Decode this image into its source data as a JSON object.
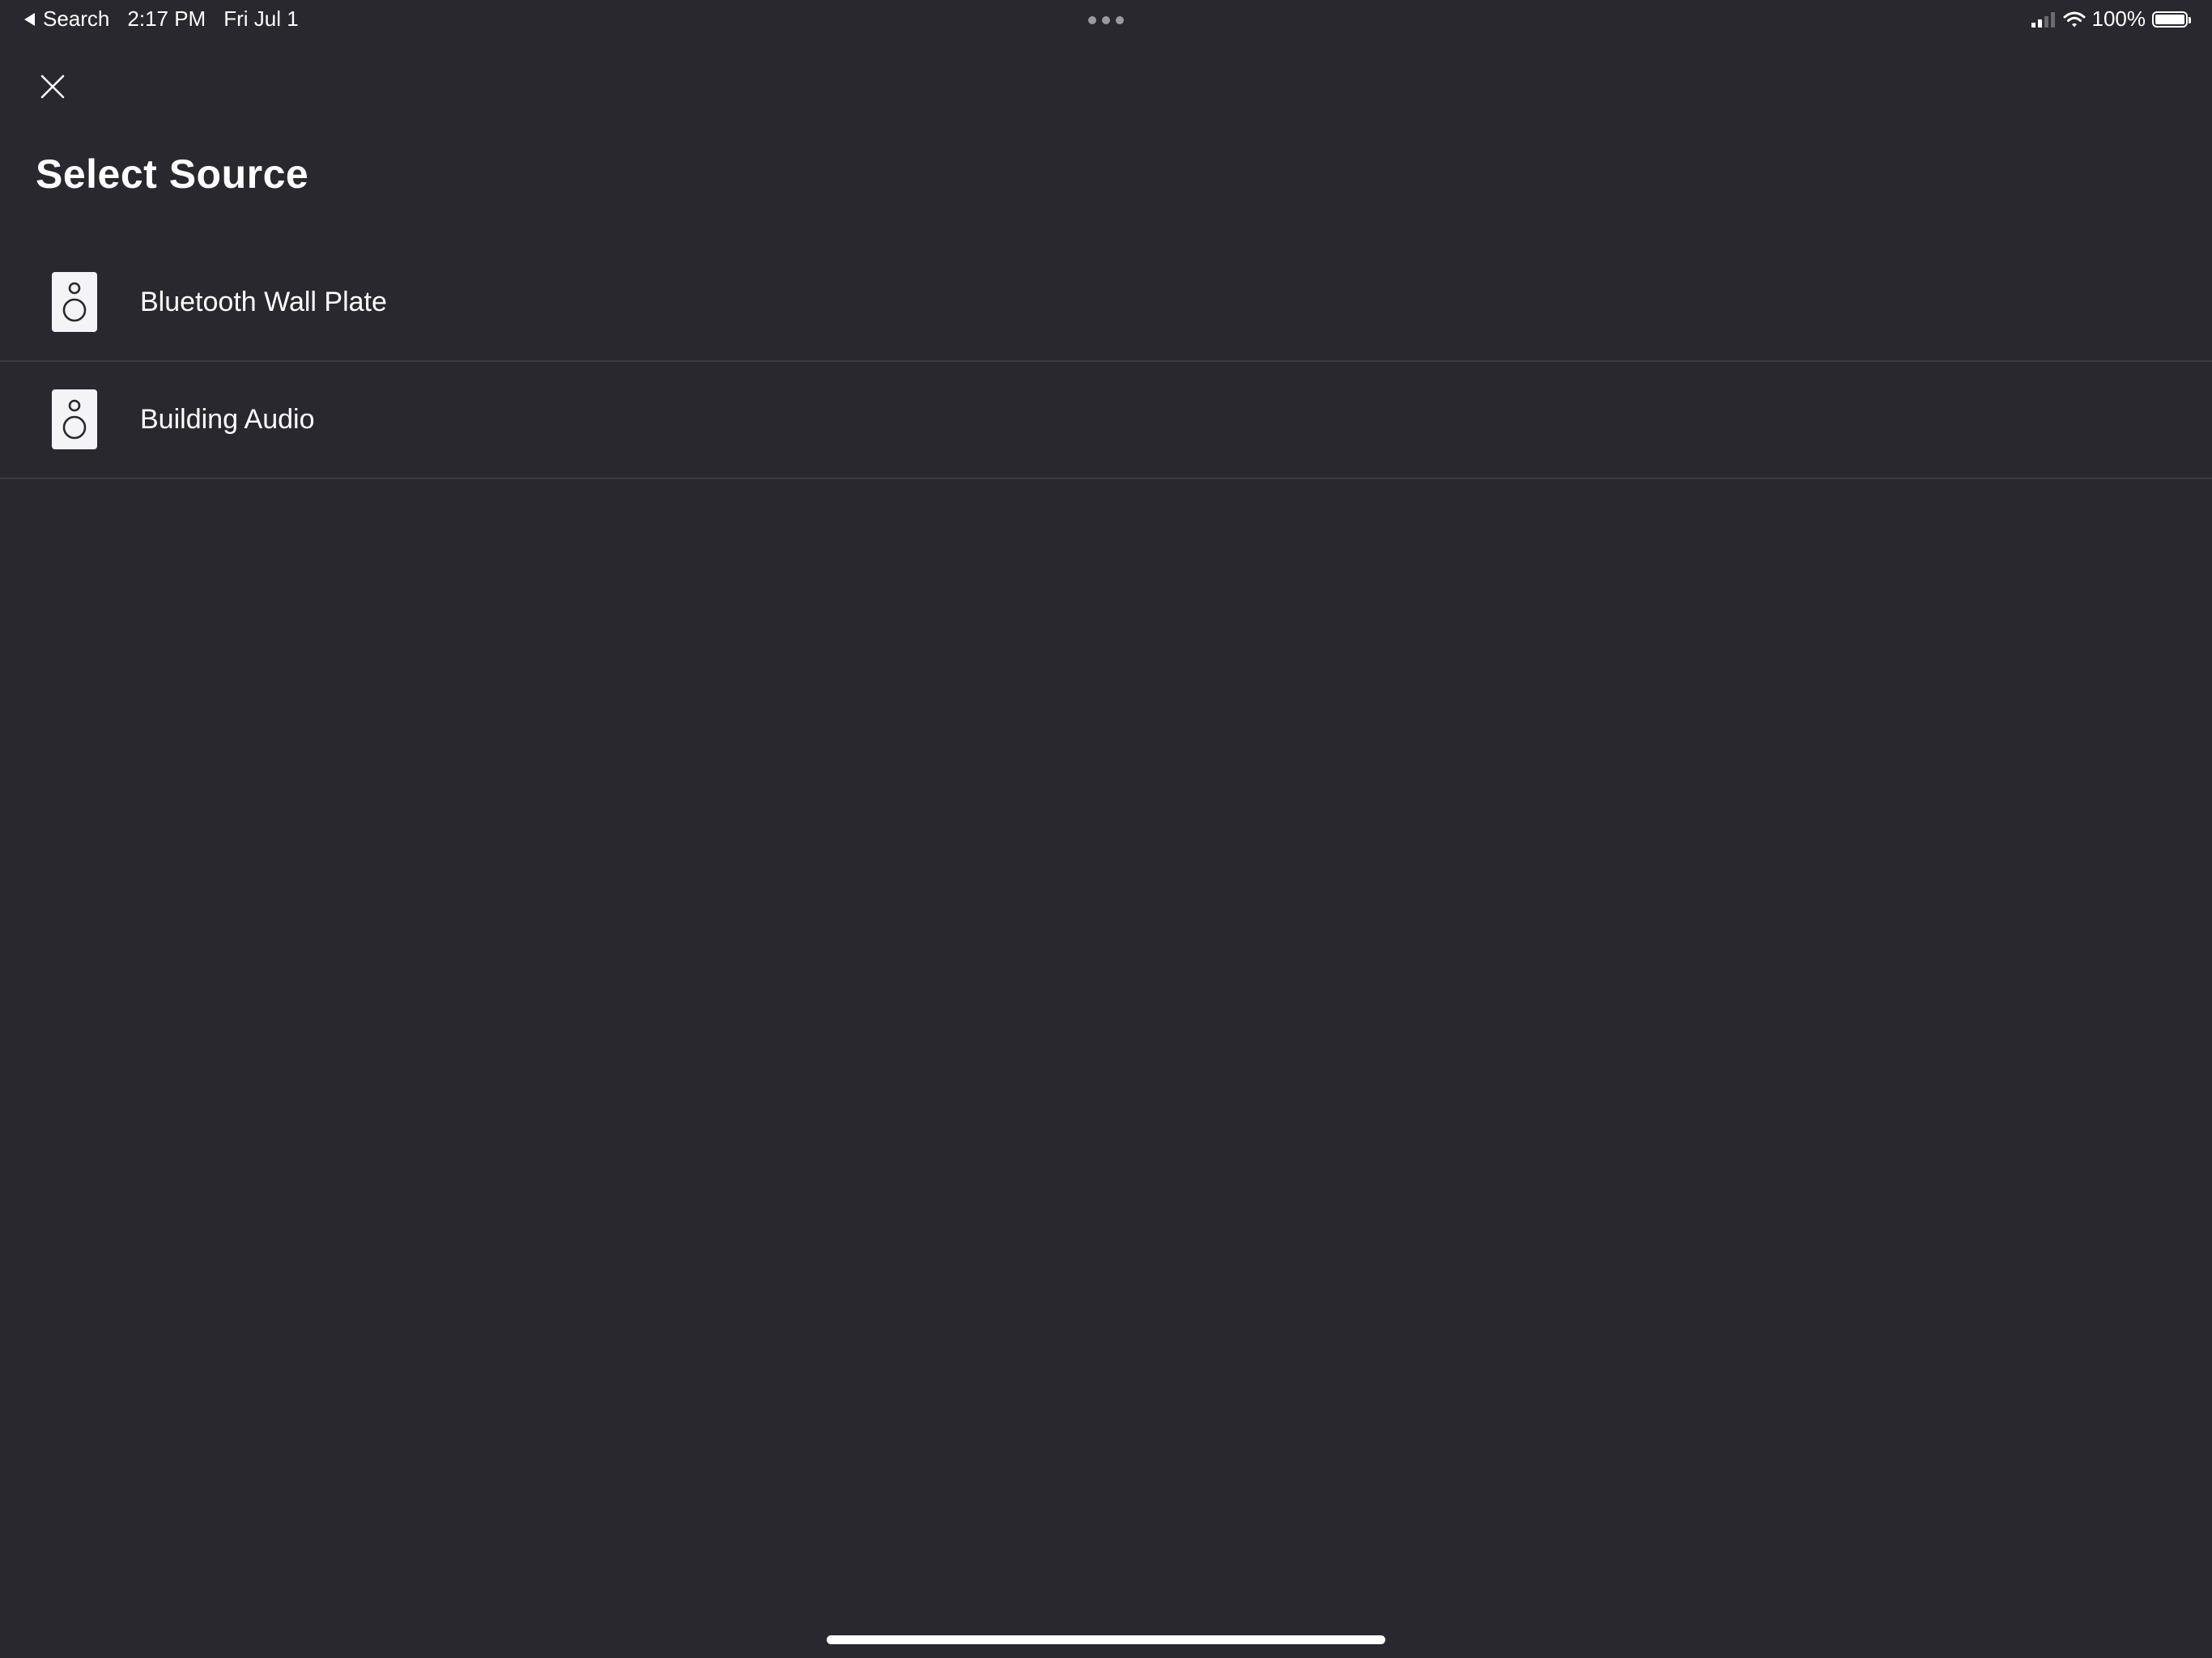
{
  "status_bar": {
    "back_app": "Search",
    "time": "2:17 PM",
    "date": "Fri Jul 1",
    "battery_percent": "100%",
    "battery_level": 1.0,
    "signal_bars_active": 2,
    "signal_bars_total": 4
  },
  "header": {
    "close_icon": "close-icon",
    "title": "Select Source"
  },
  "sources": [
    {
      "label": "Bluetooth Wall Plate",
      "icon": "speaker-icon"
    },
    {
      "label": "Building Audio",
      "icon": "speaker-icon"
    }
  ],
  "colors": {
    "background": "#28282e",
    "divider": "#3a3a40",
    "text": "#ffffff",
    "icon_tile": "#f4f4f6",
    "icon_stroke": "#28282e"
  }
}
